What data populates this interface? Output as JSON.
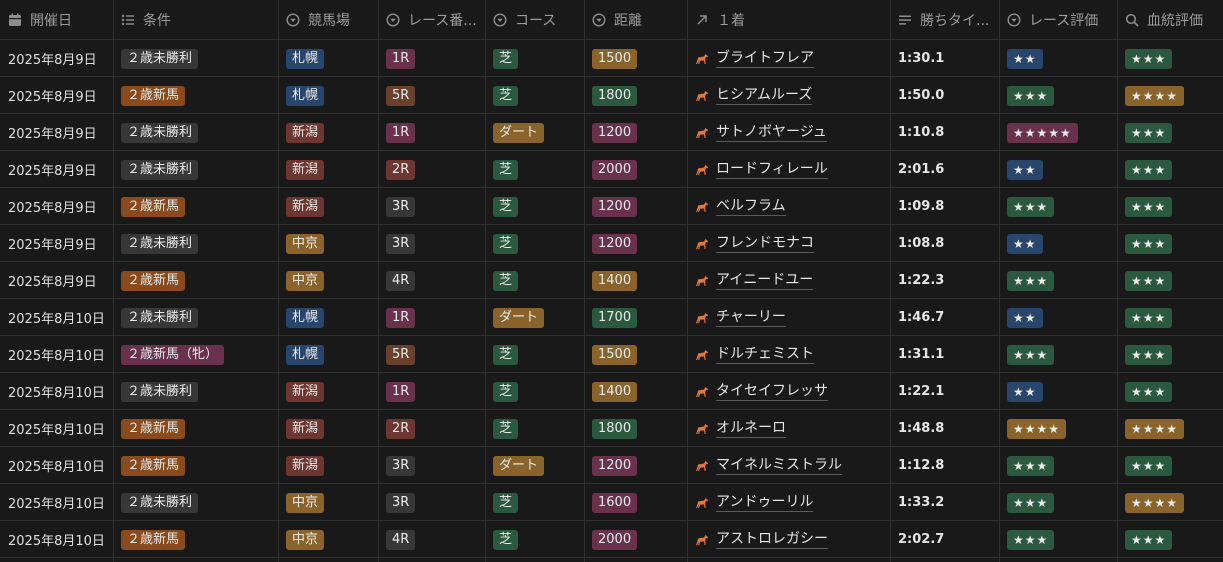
{
  "columns": [
    {
      "label": "開催日",
      "icon": "calendar-icon"
    },
    {
      "label": "条件",
      "icon": "list-icon"
    },
    {
      "label": "競馬場",
      "icon": "select-icon"
    },
    {
      "label": "レース番...",
      "icon": "select-icon"
    },
    {
      "label": "コース",
      "icon": "select-icon"
    },
    {
      "label": "距離",
      "icon": "select-icon"
    },
    {
      "label": "１着",
      "icon": "relation-arrow-icon"
    },
    {
      "label": "勝ちタイ...",
      "icon": "text-icon"
    },
    {
      "label": "レース評価",
      "icon": "select-icon"
    },
    {
      "label": "血統評価",
      "icon": "search-icon"
    }
  ],
  "colors": {
    "gray": "#373737",
    "orange": "#8b4a1c",
    "blue": "#28456c",
    "red": "#6e3630",
    "brown": "#6a3f2c",
    "yellow": "#89632a",
    "green": "#2b593f",
    "pink": "#69314c",
    "purple": "#5a3a6e"
  },
  "rows": [
    {
      "date": "2025年8月9日",
      "condition": "２歳未勝利",
      "cond_color": "gray",
      "venue": "札幌",
      "venue_color": "blue",
      "race": "1R",
      "race_color": "pink",
      "course": "芝",
      "course_color": "green",
      "distance": "1500",
      "dist_color": "yellow",
      "winner": "ブライトフレア",
      "time": "1:30.1",
      "race_rating": "★★",
      "race_rating_color": "blue",
      "blood_rating": "★★★",
      "blood_rating_color": "green"
    },
    {
      "date": "2025年8月9日",
      "condition": "２歳新馬",
      "cond_color": "orange",
      "venue": "札幌",
      "venue_color": "blue",
      "race": "5R",
      "race_color": "brown",
      "course": "芝",
      "course_color": "green",
      "distance": "1800",
      "dist_color": "green",
      "winner": "ヒシアムルーズ",
      "time": "1:50.0",
      "race_rating": "★★★",
      "race_rating_color": "green",
      "blood_rating": "★★★★",
      "blood_rating_color": "yellow"
    },
    {
      "date": "2025年8月9日",
      "condition": "２歳未勝利",
      "cond_color": "gray",
      "venue": "新潟",
      "venue_color": "red",
      "race": "1R",
      "race_color": "pink",
      "course": "ダート",
      "course_color": "yellow",
      "distance": "1200",
      "dist_color": "pink",
      "winner": "サトノボヤージュ",
      "time": "1:10.8",
      "race_rating": "★★★★★",
      "race_rating_color": "pink",
      "blood_rating": "★★★",
      "blood_rating_color": "green"
    },
    {
      "date": "2025年8月9日",
      "condition": "２歳未勝利",
      "cond_color": "gray",
      "venue": "新潟",
      "venue_color": "red",
      "race": "2R",
      "race_color": "red",
      "course": "芝",
      "course_color": "green",
      "distance": "2000",
      "dist_color": "pink",
      "winner": "ロードフィレール",
      "time": "2:01.6",
      "race_rating": "★★",
      "race_rating_color": "blue",
      "blood_rating": "★★★",
      "blood_rating_color": "green"
    },
    {
      "date": "2025年8月9日",
      "condition": "２歳新馬",
      "cond_color": "orange",
      "venue": "新潟",
      "venue_color": "red",
      "race": "3R",
      "race_color": "gray",
      "course": "芝",
      "course_color": "green",
      "distance": "1200",
      "dist_color": "pink",
      "winner": "ベルフラム",
      "time": "1:09.8",
      "race_rating": "★★★",
      "race_rating_color": "green",
      "blood_rating": "★★★",
      "blood_rating_color": "green"
    },
    {
      "date": "2025年8月9日",
      "condition": "２歳未勝利",
      "cond_color": "gray",
      "venue": "中京",
      "venue_color": "yellow",
      "race": "3R",
      "race_color": "gray",
      "course": "芝",
      "course_color": "green",
      "distance": "1200",
      "dist_color": "pink",
      "winner": "フレンドモナコ",
      "time": "1:08.8",
      "race_rating": "★★",
      "race_rating_color": "blue",
      "blood_rating": "★★★",
      "blood_rating_color": "green"
    },
    {
      "date": "2025年8月9日",
      "condition": "２歳新馬",
      "cond_color": "orange",
      "venue": "中京",
      "venue_color": "yellow",
      "race": "4R",
      "race_color": "gray",
      "course": "芝",
      "course_color": "green",
      "distance": "1400",
      "dist_color": "yellow",
      "winner": "アイニードユー",
      "time": "1:22.3",
      "race_rating": "★★★",
      "race_rating_color": "green",
      "blood_rating": "★★★",
      "blood_rating_color": "green"
    },
    {
      "date": "2025年8月10日",
      "condition": "２歳未勝利",
      "cond_color": "gray",
      "venue": "札幌",
      "venue_color": "blue",
      "race": "1R",
      "race_color": "pink",
      "course": "ダート",
      "course_color": "yellow",
      "distance": "1700",
      "dist_color": "green",
      "winner": "チャーリー",
      "time": "1:46.7",
      "race_rating": "★★",
      "race_rating_color": "blue",
      "blood_rating": "★★★",
      "blood_rating_color": "green"
    },
    {
      "date": "2025年8月10日",
      "condition": "２歳新馬（牝）",
      "cond_color": "pink",
      "venue": "札幌",
      "venue_color": "blue",
      "race": "5R",
      "race_color": "brown",
      "course": "芝",
      "course_color": "green",
      "distance": "1500",
      "dist_color": "yellow",
      "winner": "ドルチェミスト",
      "time": "1:31.1",
      "race_rating": "★★★",
      "race_rating_color": "green",
      "blood_rating": "★★★",
      "blood_rating_color": "green"
    },
    {
      "date": "2025年8月10日",
      "condition": "２歳未勝利",
      "cond_color": "gray",
      "venue": "新潟",
      "venue_color": "red",
      "race": "1R",
      "race_color": "pink",
      "course": "芝",
      "course_color": "green",
      "distance": "1400",
      "dist_color": "yellow",
      "winner": "タイセイフレッサ",
      "time": "1:22.1",
      "race_rating": "★★",
      "race_rating_color": "blue",
      "blood_rating": "★★★",
      "blood_rating_color": "green"
    },
    {
      "date": "2025年8月10日",
      "condition": "２歳新馬",
      "cond_color": "orange",
      "venue": "新潟",
      "venue_color": "red",
      "race": "2R",
      "race_color": "red",
      "course": "芝",
      "course_color": "green",
      "distance": "1800",
      "dist_color": "green",
      "winner": "オルネーロ",
      "time": "1:48.8",
      "race_rating": "★★★★",
      "race_rating_color": "yellow",
      "blood_rating": "★★★★",
      "blood_rating_color": "yellow"
    },
    {
      "date": "2025年8月10日",
      "condition": "２歳新馬",
      "cond_color": "orange",
      "venue": "新潟",
      "venue_color": "red",
      "race": "3R",
      "race_color": "gray",
      "course": "ダート",
      "course_color": "yellow",
      "distance": "1200",
      "dist_color": "pink",
      "winner": "マイネルミストラル",
      "time": "1:12.8",
      "race_rating": "★★★",
      "race_rating_color": "green",
      "blood_rating": "★★★",
      "blood_rating_color": "green"
    },
    {
      "date": "2025年8月10日",
      "condition": "２歳未勝利",
      "cond_color": "gray",
      "venue": "中京",
      "venue_color": "yellow",
      "race": "3R",
      "race_color": "gray",
      "course": "芝",
      "course_color": "green",
      "distance": "1600",
      "dist_color": "pink",
      "winner": "アンドゥーリル",
      "time": "1:33.2",
      "race_rating": "★★★",
      "race_rating_color": "green",
      "blood_rating": "★★★★",
      "blood_rating_color": "yellow"
    },
    {
      "date": "2025年8月10日",
      "condition": "２歳新馬",
      "cond_color": "orange",
      "venue": "中京",
      "venue_color": "yellow",
      "race": "4R",
      "race_color": "gray",
      "course": "芝",
      "course_color": "green",
      "distance": "2000",
      "dist_color": "pink",
      "winner": "アストロレガシー",
      "time": "2:02.7",
      "race_rating": "★★★",
      "race_rating_color": "green",
      "blood_rating": "★★★",
      "blood_rating_color": "green"
    }
  ]
}
